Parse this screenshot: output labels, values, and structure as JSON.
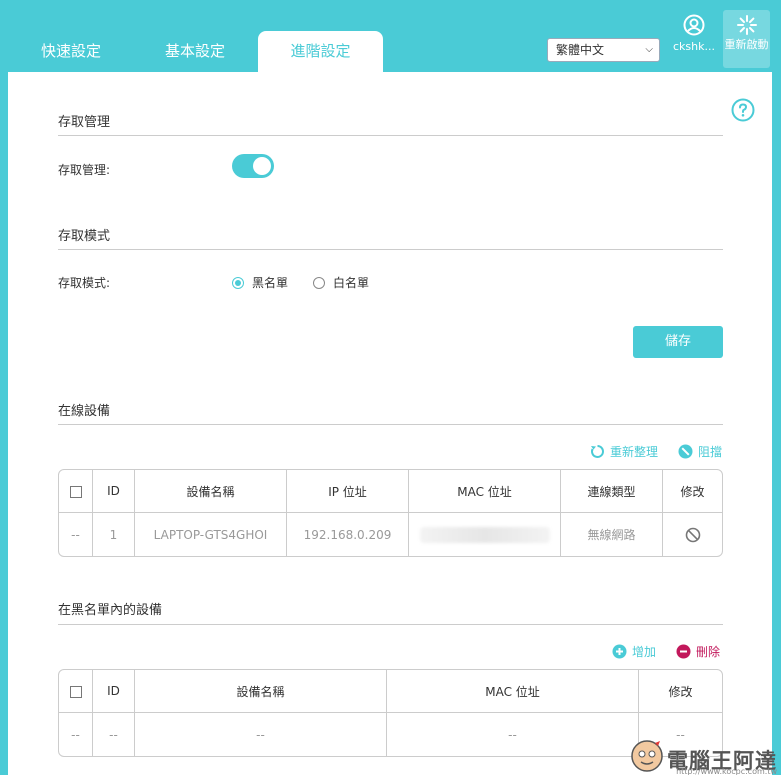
{
  "tabs": [
    "快速設定",
    "基本設定",
    "進階設定"
  ],
  "language": {
    "selected": "繁體中文"
  },
  "user": {
    "name": "ckshk..."
  },
  "reboot": {
    "label": "重新啟動"
  },
  "access_management": {
    "section_title": "存取管理",
    "toggle_label": "存取管理:",
    "enabled": true
  },
  "access_mode": {
    "section_title": "存取模式",
    "label": "存取模式:",
    "options": [
      "黑名單",
      "白名單"
    ],
    "selected": "黑名單"
  },
  "save_label": "儲存",
  "online_devices": {
    "section_title": "在線設備",
    "refresh_label": "重新整理",
    "block_label": "阻擋",
    "columns": [
      "ID",
      "設備名稱",
      "IP 位址",
      "MAC 位址",
      "連線類型",
      "修改"
    ],
    "rows": [
      {
        "select": "--",
        "id": "1",
        "name": "LAPTOP-GTS4GHOI",
        "ip": "192.168.0.209",
        "type": "無線網路"
      }
    ]
  },
  "blacklist": {
    "section_title": "在黑名單內的設備",
    "add_label": "增加",
    "delete_label": "刪除",
    "columns": [
      "ID",
      "設備名稱",
      "MAC 位址",
      "修改"
    ],
    "rows": [
      {
        "select": "--",
        "id": "--",
        "name": "--",
        "mac": "--",
        "modify": "--"
      }
    ]
  },
  "watermark": {
    "text": "電腦王阿達",
    "url": "http://www.kocpc.com.tw"
  },
  "colors": {
    "accent": "#4acbd6",
    "danger": "#c2185b"
  }
}
